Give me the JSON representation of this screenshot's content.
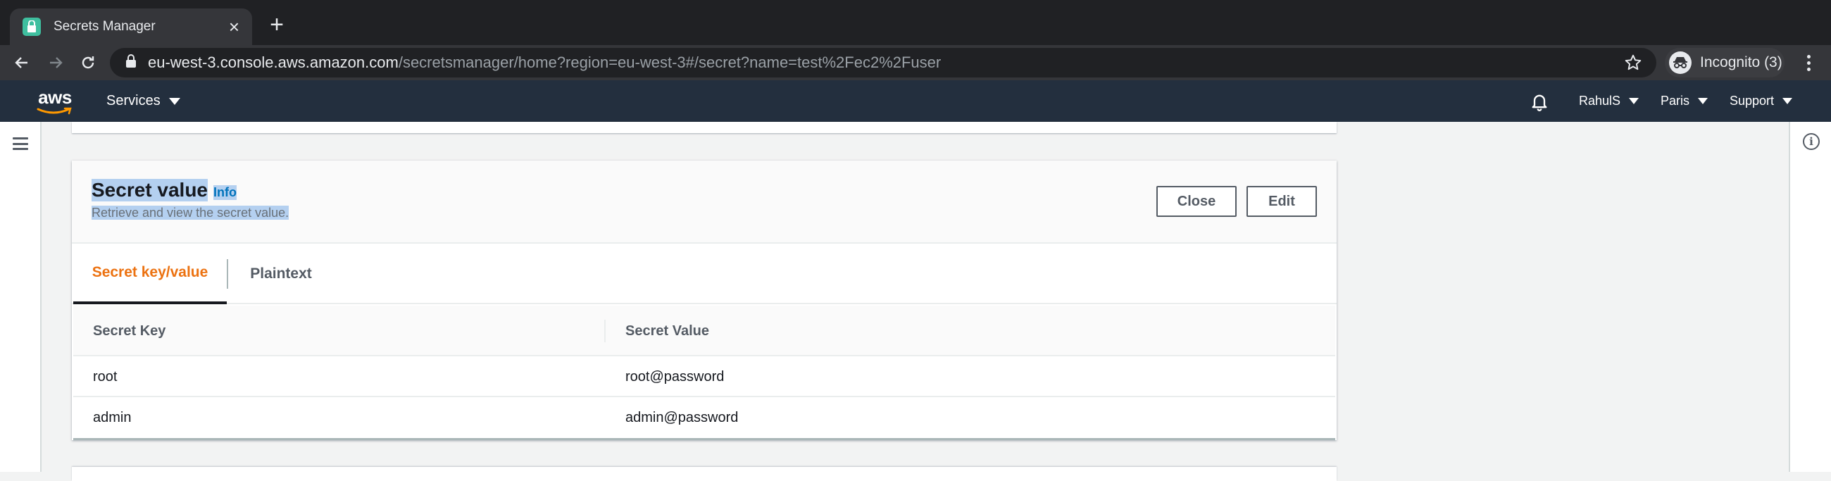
{
  "browser": {
    "tab_title": "Secrets Manager",
    "url_host": "eu-west-3.console.aws.amazon.com",
    "url_path": "/secretsmanager/home?region=eu-west-3#/secret?name=test%2Fec2%2Fuser",
    "profile_label": "Incognito (3)"
  },
  "aws_nav": {
    "logo_text": "aws",
    "services_label": "Services",
    "user_label": "RahulS",
    "region_label": "Paris",
    "support_label": "Support"
  },
  "secret_card": {
    "title": "Secret value",
    "info_label": "Info",
    "description": "Retrieve and view the secret value.",
    "close_label": "Close",
    "edit_label": "Edit",
    "tabs": [
      {
        "label": "Secret key/value",
        "active": true
      },
      {
        "label": "Plaintext",
        "active": false
      }
    ],
    "table": {
      "columns": [
        "Secret Key",
        "Secret Value"
      ],
      "rows": [
        {
          "key": "root",
          "value": "root@password"
        },
        {
          "key": "admin",
          "value": "admin@password"
        }
      ]
    }
  },
  "colors": {
    "aws_nav_bg": "#232f3e",
    "active_tab": "#ec7211",
    "link": "#0073bb",
    "selection_highlight": "#b4d0f0"
  },
  "icons": [
    "secrets-manager-favicon",
    "close-icon",
    "plus-icon",
    "back-arrow-icon",
    "forward-arrow-icon",
    "reload-icon",
    "lock-icon",
    "star-icon",
    "incognito-icon",
    "kebab-menu-icon",
    "aws-smile-icon",
    "bell-icon",
    "hamburger-icon",
    "info-icon"
  ]
}
